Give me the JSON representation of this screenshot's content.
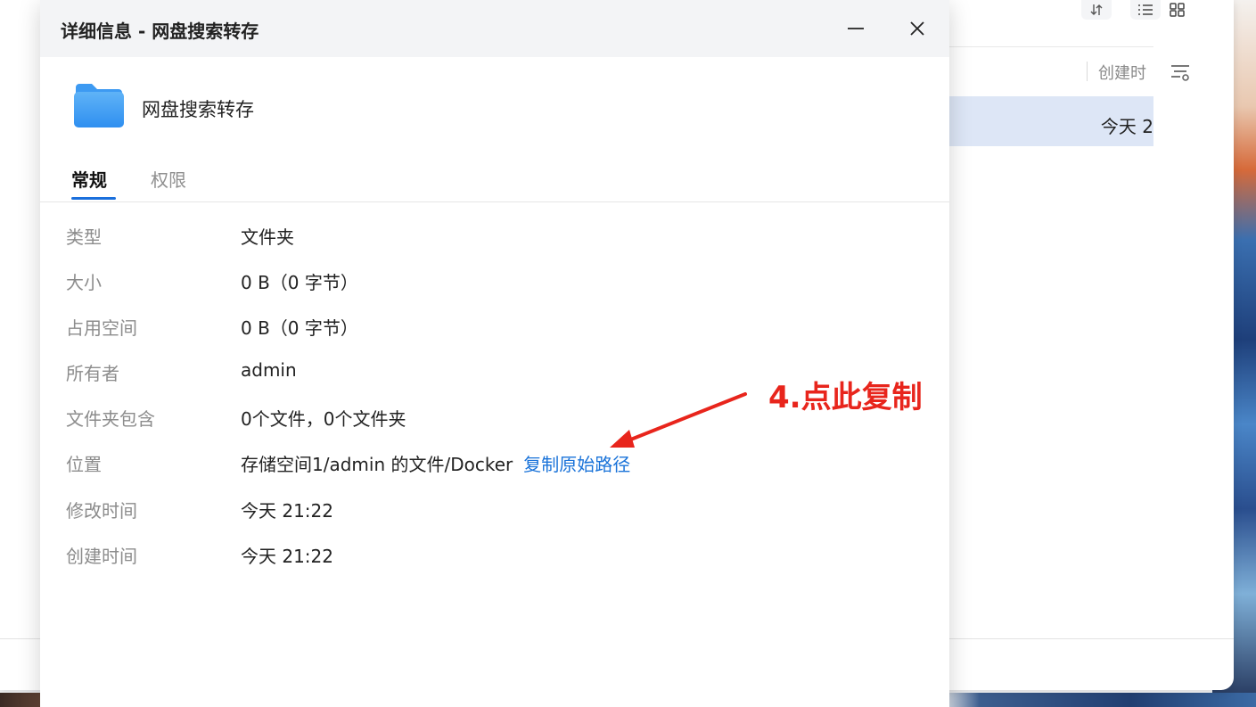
{
  "background_window": {
    "column_header": "创建时",
    "row_date": "今天 2",
    "toolbar_icons": [
      "sort-icon",
      "list-view-icon",
      "grid-view-icon"
    ]
  },
  "dialog": {
    "title": "详细信息 - 网盘搜索转存",
    "folder_name": "网盘搜索转存",
    "controls": [
      "minimize-icon",
      "close-icon"
    ],
    "tabs": [
      {
        "label": "常规",
        "active": true
      },
      {
        "label": "权限",
        "active": false
      }
    ],
    "properties": [
      {
        "label": "类型",
        "value": "文件夹"
      },
      {
        "label": "大小",
        "value": "0 B（0 字节）"
      },
      {
        "label": "占用空间",
        "value": "0 B（0 字节）"
      },
      {
        "label": "所有者",
        "value": "admin"
      },
      {
        "label": "文件夹包含",
        "value": "0个文件，0个文件夹"
      },
      {
        "label": "位置",
        "value": "存储空间1/admin 的文件/Docker",
        "link": "复制原始路径"
      },
      {
        "label": "修改时间",
        "value": "今天 21:22"
      },
      {
        "label": "创建时间",
        "value": "今天 21:22"
      }
    ]
  },
  "annotation": {
    "text": "4.点此复制",
    "color": "#e8251c"
  },
  "colors": {
    "accent": "#1a6fdc",
    "link": "#1a73d9",
    "selected_row": "#dde6f6"
  }
}
